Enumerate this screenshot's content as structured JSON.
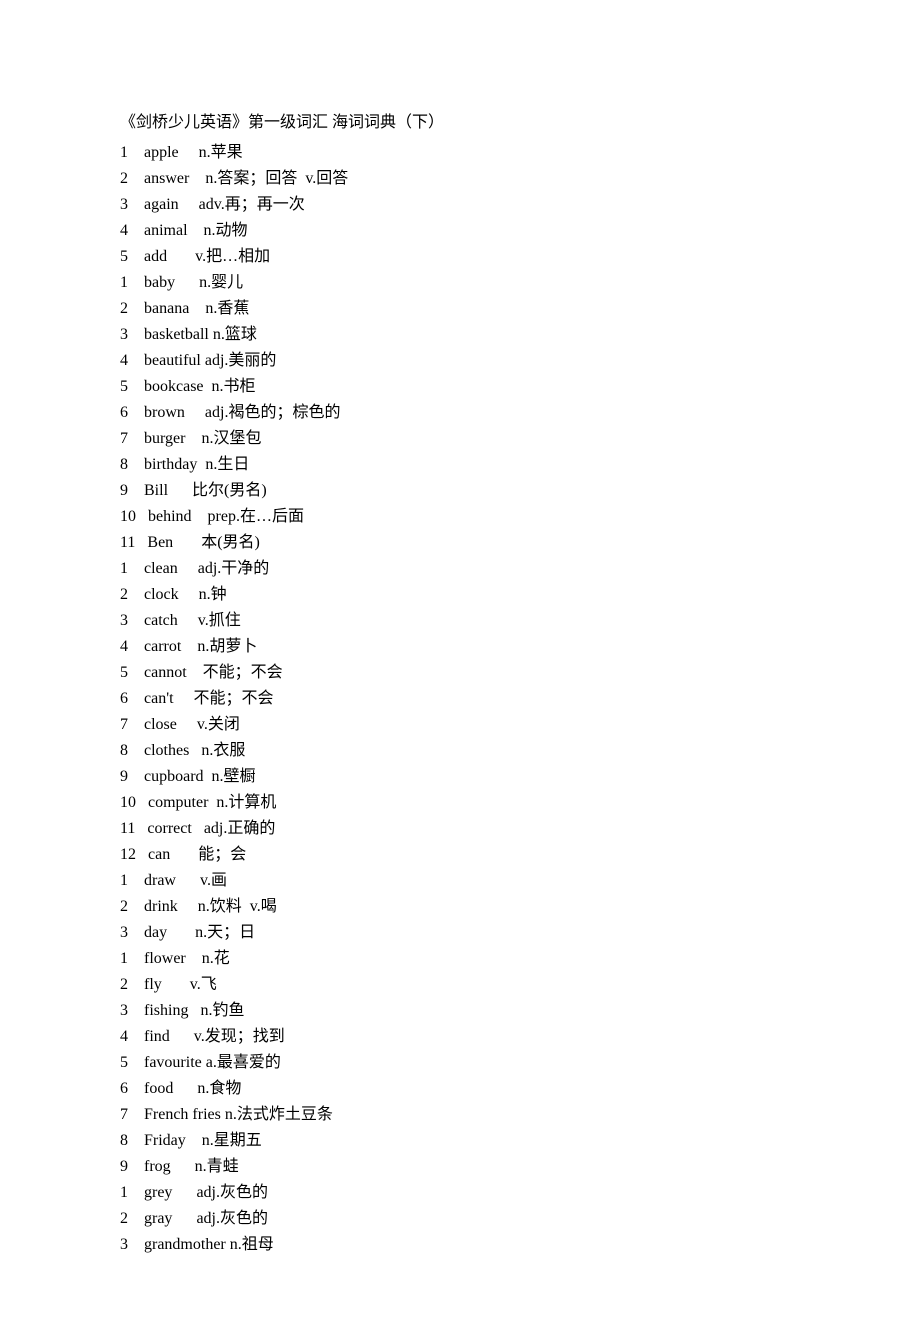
{
  "title": "《剑桥少儿英语》第一级词汇 海词词典（下）",
  "entries": [
    {
      "num": "1",
      "word": "apple",
      "def": "n.苹果"
    },
    {
      "num": "2",
      "word": "answer",
      "def": "n.答案；回答  v.回答"
    },
    {
      "num": "3",
      "word": "again",
      "def": "adv.再；再一次"
    },
    {
      "num": "4",
      "word": "animal",
      "def": "n.动物"
    },
    {
      "num": "5",
      "word": "add",
      "def": "v.把…相加"
    },
    {
      "num": "1",
      "word": "baby",
      "def": "n.婴儿"
    },
    {
      "num": "2",
      "word": "banana",
      "def": "n.香蕉"
    },
    {
      "num": "3",
      "word": "basketball",
      "def": "n.篮球"
    },
    {
      "num": "4",
      "word": "beautiful",
      "def": "adj.美丽的"
    },
    {
      "num": "5",
      "word": "bookcase",
      "def": "n.书柜"
    },
    {
      "num": "6",
      "word": "brown",
      "def": "adj.褐色的；棕色的"
    },
    {
      "num": "7",
      "word": "burger",
      "def": "n.汉堡包"
    },
    {
      "num": "8",
      "word": "birthday",
      "def": "n.生日"
    },
    {
      "num": "9",
      "word": "Bill",
      "def": "比尔(男名)"
    },
    {
      "num": "10",
      "word": "behind",
      "def": "prep.在…后面"
    },
    {
      "num": "11",
      "word": "Ben",
      "def": "本(男名)"
    },
    {
      "num": "1",
      "word": "clean",
      "def": "adj.干净的"
    },
    {
      "num": "2",
      "word": "clock",
      "def": "n.钟"
    },
    {
      "num": "3",
      "word": "catch",
      "def": "v.抓住"
    },
    {
      "num": "4",
      "word": "carrot",
      "def": "n.胡萝卜"
    },
    {
      "num": "5",
      "word": "cannot",
      "def": "不能；不会"
    },
    {
      "num": "6",
      "word": "can't",
      "def": "不能；不会"
    },
    {
      "num": "7",
      "word": "close",
      "def": "v.关闭"
    },
    {
      "num": "8",
      "word": "clothes",
      "def": "n.衣服"
    },
    {
      "num": "9",
      "word": "cupboard",
      "def": "n.壁橱"
    },
    {
      "num": "10",
      "word": "computer",
      "def": "n.计算机"
    },
    {
      "num": "11",
      "word": "correct",
      "def": "adj.正确的"
    },
    {
      "num": "12",
      "word": "can",
      "def": "能；会"
    },
    {
      "num": "1",
      "word": "draw",
      "def": "v.画"
    },
    {
      "num": "2",
      "word": "drink",
      "def": "n.饮料  v.喝"
    },
    {
      "num": "3",
      "word": "day",
      "def": "n.天；日"
    },
    {
      "num": "1",
      "word": "flower",
      "def": "n.花"
    },
    {
      "num": "2",
      "word": "fly",
      "def": "v.飞"
    },
    {
      "num": "3",
      "word": "fishing",
      "def": "n.钓鱼"
    },
    {
      "num": "4",
      "word": "find",
      "def": "v.发现；找到"
    },
    {
      "num": "5",
      "word": "favourite",
      "def": "a.最喜爱的"
    },
    {
      "num": "6",
      "word": "food",
      "def": "n.食物"
    },
    {
      "num": "7",
      "word": "French fries",
      "def": "n.法式炸土豆条"
    },
    {
      "num": "8",
      "word": "Friday",
      "def": "n.星期五"
    },
    {
      "num": "9",
      "word": "frog",
      "def": "n.青蛙"
    },
    {
      "num": "1",
      "word": "grey",
      "def": "adj.灰色的"
    },
    {
      "num": "2",
      "word": "gray",
      "def": "adj.灰色的"
    },
    {
      "num": "3",
      "word": "grandmother",
      "def": "n.祖母"
    }
  ]
}
